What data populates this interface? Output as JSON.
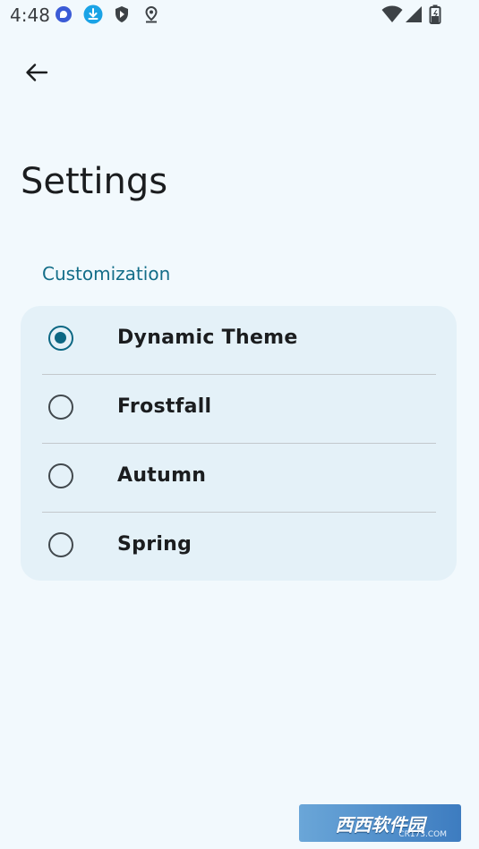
{
  "status_bar": {
    "time": "4:48",
    "left_icons": [
      "chat-bubble-icon",
      "download-icon",
      "shield-icon",
      "location-pin-icon"
    ],
    "right_icons": [
      "wifi-icon",
      "signal-icon",
      "battery-charging-icon"
    ]
  },
  "header": {
    "back_icon": "arrow-back-icon",
    "title": "Settings"
  },
  "customization": {
    "section_title": "Customization",
    "options": [
      {
        "label": "Dynamic Theme",
        "selected": true
      },
      {
        "label": "Frostfall",
        "selected": false
      },
      {
        "label": "Autumn",
        "selected": false
      },
      {
        "label": "Spring",
        "selected": false
      }
    ]
  },
  "watermark": {
    "text": "西西软件园",
    "sub": "CR173.COM"
  },
  "colors": {
    "background": "#f2f9fd",
    "card": "#e4f1f8",
    "accent": "#0c6783",
    "section_title": "#136d88"
  }
}
